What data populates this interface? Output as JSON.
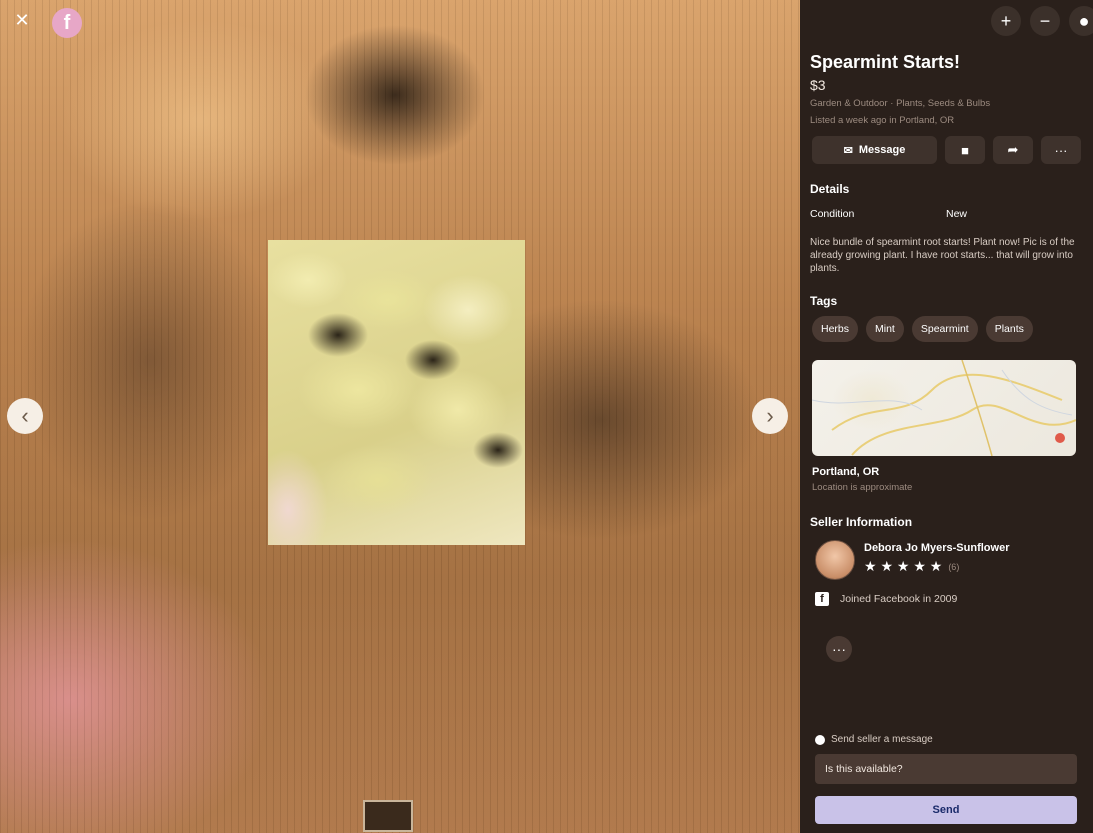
{
  "viewer": {
    "close_glyph": "✕",
    "logo_glyph": "f",
    "prev_glyph": "‹",
    "next_glyph": "›"
  },
  "top_actions": {
    "add_glyph": "+",
    "minus_glyph": "−",
    "more_glyph": "●"
  },
  "listing": {
    "title": "Spearmint Starts!",
    "price": "$3",
    "breadcrumb": "Garden & Outdoor · Plants, Seeds & Bulbs",
    "listed": "Listed a week ago in Portland, OR"
  },
  "actions": {
    "message_label": "Message",
    "message_glyph": "✉",
    "save_glyph": "■",
    "share_glyph": "➦",
    "more_glyph": "···"
  },
  "details": {
    "heading": "Details",
    "condition_label": "Condition",
    "condition_value": "New",
    "description": "Nice bundle of spearmint root starts! Plant now! Pic is of the already growing plant. I have root starts... that will grow into plants."
  },
  "tags": {
    "heading": "Tags",
    "items": [
      "Herbs",
      "Mint",
      "Spearmint",
      "Plants"
    ]
  },
  "location": {
    "city": "Portland, OR",
    "note": "Location is approximate"
  },
  "seller": {
    "heading": "Seller Information",
    "name": "Debora Jo Myers-Sunflower",
    "stars": "★ ★ ★ ★ ★",
    "rating_count": "(6)",
    "joined": "Joined Facebook in 2009",
    "fb_glyph": "f",
    "more_glyph": "···"
  },
  "message_box": {
    "prompt": "Send seller a message",
    "input_value": "Is this available?",
    "send_label": "Send"
  }
}
